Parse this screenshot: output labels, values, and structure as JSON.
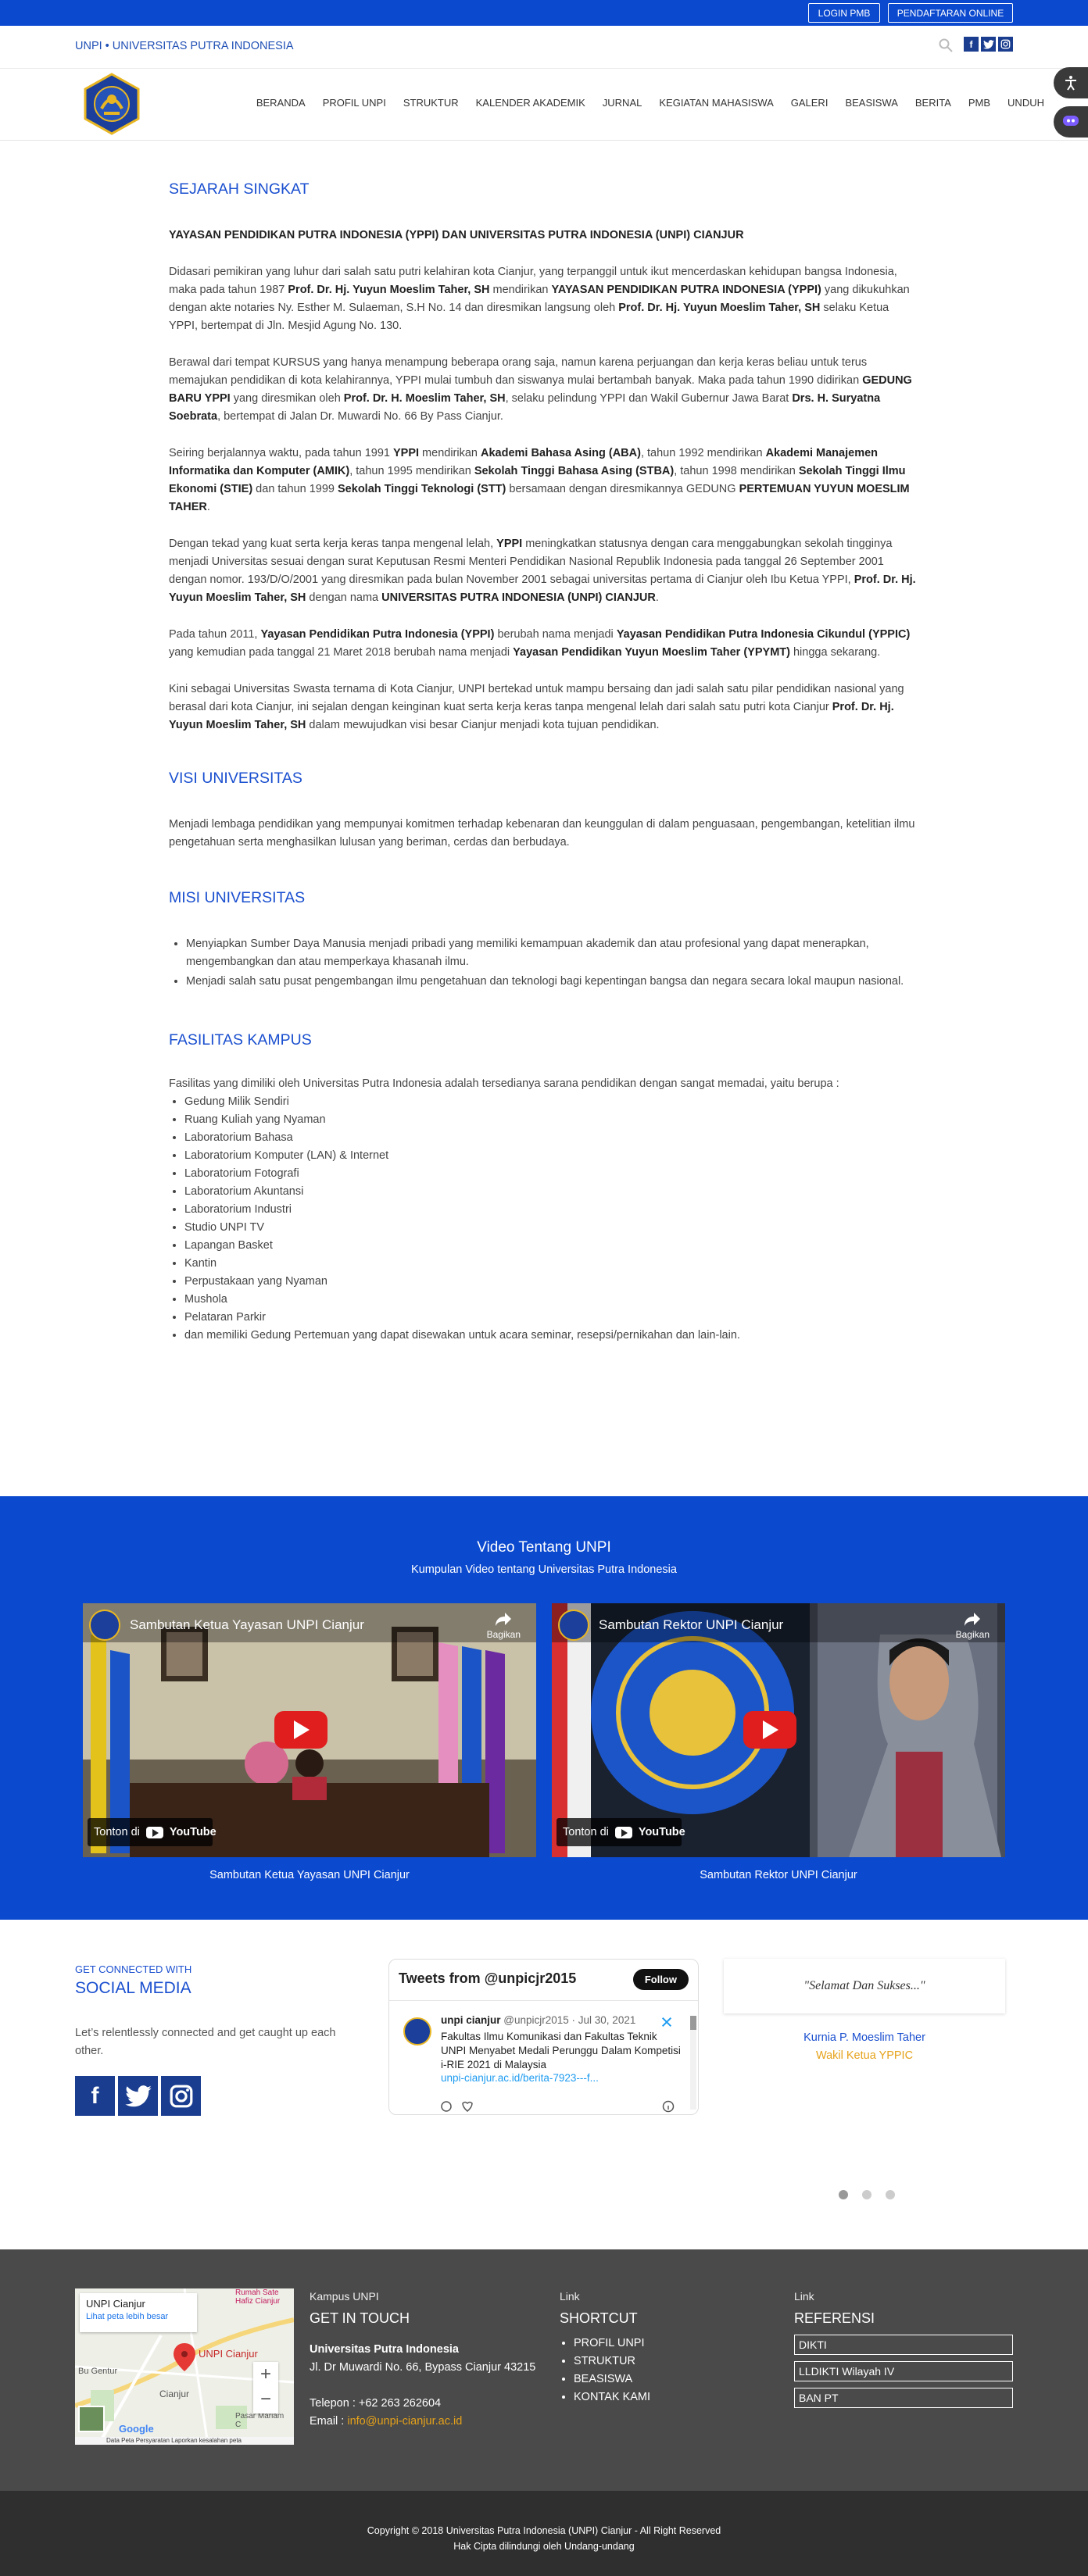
{
  "topbar": {
    "login": "LOGIN PMB",
    "daftar": "PENDAFTARAN ONLINE"
  },
  "brand": {
    "text": "UNPI • UNIVERSITAS PUTRA INDONESIA"
  },
  "nav": [
    "BERANDA",
    "PROFIL UNPI",
    "STRUKTUR",
    "KALENDER AKADEMIK",
    "JURNAL",
    "KEGIATAN MAHASISWA",
    "GALERI",
    "BEASISWA",
    "BERITA",
    "PMB",
    "UNDUH"
  ],
  "sejarah": {
    "heading": "SEJARAH SINGKAT",
    "sub": "YAYASAN PENDIDIKAN PUTRA INDONESIA (YPPI) DAN UNIVERSITAS PUTRA INDONESIA (UNPI) CIANJUR",
    "p1": "Didasari pemikiran yang luhur dari salah satu putri kelahiran kota Cianjur, yang terpanggil untuk ikut mencerdaskan kehidupan bangsa Indonesia, maka pada tahun 1987 <b>Prof. Dr. Hj. Yuyun Moeslim Taher, SH</b> mendirikan <b>YAYASAN PENDIDIKAN PUTRA INDONESIA (YPPI)</b> yang dikukuhkan dengan akte notaries Ny. Esther M. Sulaeman, S.H  No. 14 dan diresmikan langsung oleh <b>Prof. Dr. Hj. Yuyun Moeslim Taher, SH</b> selaku Ketua YPPI, bertempat di Jln. Mesjid Agung No. 130.",
    "p2": "Berawal dari tempat KURSUS  yang hanya menampung beberapa orang saja, namun karena perjuangan dan kerja keras beliau untuk terus memajukan pendidikan di kota kelahirannya, YPPI mulai tumbuh dan siswanya mulai bertambah banyak. Maka pada tahun 1990 didirikan <b>GEDUNG BARU YPPI</b>  yang diresmikan oleh <b>Prof. Dr. H. Moeslim Taher, SH</b>, selaku pelindung YPPI dan Wakil Gubernur Jawa Barat <b>Drs. H. Suryatna Soebrata</b>, bertempat di Jalan Dr. Muwardi No. 66 By Pass Cianjur.",
    "p3": "Seiring berjalannya waktu, pada tahun 1991 <b>YPPI</b> mendirikan <b>Akademi Bahasa  Asing  (ABA)</b>, tahun 1992 mendirikan <b>Akademi Manajemen Informatika dan Komputer (AMIK)</b>, tahun 1995 mendirikan <b>Sekolah Tinggi Bahasa Asing (STBA)</b>, tahun 1998 mendirikan <b>Sekolah Tinggi Ilmu Ekonomi (STIE)</b> dan tahun 1999 <b>Sekolah Tinggi Teknologi (STT)</b> bersamaan dengan diresmikannya GEDUNG <b>PERTEMUAN YUYUN MOESLIM TAHER</b>.",
    "p4": "Dengan tekad yang kuat serta kerja keras tanpa mengenal lelah, <b>YPPI</b> meningkatkan statusnya dengan cara menggabungkan sekolah tingginya menjadi Universitas sesuai dengan surat Keputusan Resmi Menteri Pendidikan Nasional Republik Indonesia pada tanggal 26 September 2001 dengan nomor. 193/D/O/2001 yang diresmikan pada bulan November 2001 sebagai universitas pertama di Cianjur oleh Ibu Ketua YPPI, <b>Prof. Dr. Hj. Yuyun Moeslim Taher, SH</b> dengan nama <b>UNIVERSITAS PUTRA INDONESIA  (UNPI) CIANJUR</b>.",
    "p5": "Pada tahun 2011, <b>Yayasan Pendidikan Putra Indonesia (YPPI)</b> berubah nama menjadi <b>Yayasan Pendidikan Putra Indonesia Cikundul (YPPIC)</b>  yang kemudian pada tanggal 21 Maret 2018 berubah nama menjadi <b>Yayasan Pendidikan Yuyun Moeslim Taher (YPYMT)</b> hingga sekarang.",
    "p6": "Kini sebagai Universitas Swasta ternama di Kota Cianjur, UNPI bertekad untuk mampu bersaing dan jadi salah satu pilar pendidikan nasional yang berasal dari kota Cianjur, ini sejalan dengan keinginan kuat serta kerja keras tanpa mengenal lelah dari salah satu putri kota Cianjur <b>Prof. Dr. Hj.  Yuyun Moeslim Taher, SH</b> dalam mewujudkan visi besar Cianjur menjadi kota tujuan pendidikan."
  },
  "visi": {
    "heading": "VISI UNIVERSITAS",
    "text": "Menjadi lembaga pendidikan yang mempunyai komitmen terhadap kebenaran dan keunggulan di dalam penguasaan, pengembangan, ketelitian ilmu pengetahuan serta menghasilkan lulusan yang beriman, cerdas dan berbudaya."
  },
  "misi": {
    "heading": "MISI UNIVERSITAS",
    "items": [
      "Menyiapkan Sumber Daya Manusia menjadi pribadi yang memiliki kemampuan akademik dan atau profesional yang dapat menerapkan, mengembangkan dan atau memperkaya khasanah ilmu.",
      "Menjadi salah satu pusat pengembangan ilmu pengetahuan dan teknologi bagi kepentingan bangsa dan negara secara lokal maupun nasional."
    ]
  },
  "fasilitas": {
    "heading": "FASILITAS KAMPUS",
    "intro": "Fasilitas yang dimiliki oleh Universitas Putra Indonesia adalah tersedianya sarana pendidikan dengan sangat memadai, yaitu berupa :",
    "items": [
      "Gedung Milik Sendiri",
      "Ruang Kuliah yang Nyaman",
      "Laboratorium Bahasa",
      "Laboratorium Komputer (LAN) & Internet",
      "Laboratorium Fotografi",
      "Laboratorium Akuntansi",
      "Laboratorium Industri",
      "Studio UNPI TV",
      "Lapangan Basket",
      "Kantin",
      "Perpustakaan yang Nyaman",
      "Mushola",
      "Pelataran Parkir",
      "dan memiliki Gedung Pertemuan yang dapat disewakan untuk acara seminar, resepsi/pernikahan dan lain-lain."
    ]
  },
  "video": {
    "title": "Video Tentang UNPI",
    "subtitle": "Kumpulan Video tentang Universitas Putra Indonesia",
    "items": [
      {
        "title": "Sambutan Ketua Yayasan UNPI Cianjur",
        "caption": "Sambutan Ketua Yayasan UNPI Cianjur"
      },
      {
        "title": "Sambutan Rektor UNPI Cianjur",
        "caption": "Sambutan Rektor UNPI Cianjur"
      }
    ],
    "share": "Bagikan",
    "watch": "Tonton di",
    "youtube": "YouTube"
  },
  "social": {
    "connected": "GET CONNECTED WITH",
    "media": "SOCIAL MEDIA",
    "text": "Let’s relentlessly connected and get caught up each other."
  },
  "twitter": {
    "header": "Tweets from @unpicjr2015",
    "follow": "Follow",
    "name": "unpi cianjur",
    "handle": "@unpicjr2015 · Jul 30, 2021",
    "text": "Fakultas Ilmu Komunikasi dan Fakultas Teknik UNPI Menyabet Medali Perunggu Dalam Kompetisi i-RIE 2021 di Malaysia",
    "link": "unpi-cianjur.ac.id/berita-7923---f..."
  },
  "testimonial": {
    "quote": "\"Selamat Dan Sukses...\"",
    "name": "Kurnia P. Moeslim Taher",
    "role": "Wakil Ketua YPPIC"
  },
  "map": {
    "title": "UNPI Cianjur",
    "link": "Lihat peta lebih besar",
    "pin": "UNPI Cianjur",
    "city": "Cianjur",
    "place1": "Bu Gentur",
    "place2": "Rumah Sate Hafiz Cianjur",
    "place3": "Pasar Mariam C",
    "footer": "Data Peta   Persyaratan   Laporkan kesalahan peta"
  },
  "footer": {
    "contact_label": "Kampus UNPI",
    "contact_heading": "GET IN TOUCH",
    "org": "Universitas Putra Indonesia",
    "address": "Jl. Dr Muwardi No. 66, Bypass Cianjur 43215",
    "phone": "Telepon : +62 263 262604",
    "email_label": "Email : ",
    "email": "info@unpi-cianjur.ac.id",
    "shortcut_label": "Link",
    "shortcut_heading": "SHORTCUT",
    "shortcuts": [
      "PROFIL UNPI",
      "STRUKTUR",
      "BEASISWA",
      "KONTAK KAMI"
    ],
    "ref_label": "Link",
    "ref_heading": "REFERENSI",
    "refs": [
      "DIKTI",
      "LLDIKTI Wilayah IV",
      "BAN PT"
    ]
  },
  "copyright": {
    "line1": "Copyright © 2018 Universitas Putra Indonesia (UNPI) Cianjur - All Right Reserved",
    "line2": "Hak Cipta dilindungi oleh Undang-undang"
  },
  "colors": {
    "brand_blue": "#0b49cf",
    "heading_blue": "#1a4fcf",
    "footer_bg": "#4a4a4a",
    "accent_gold": "#e6a21a"
  }
}
